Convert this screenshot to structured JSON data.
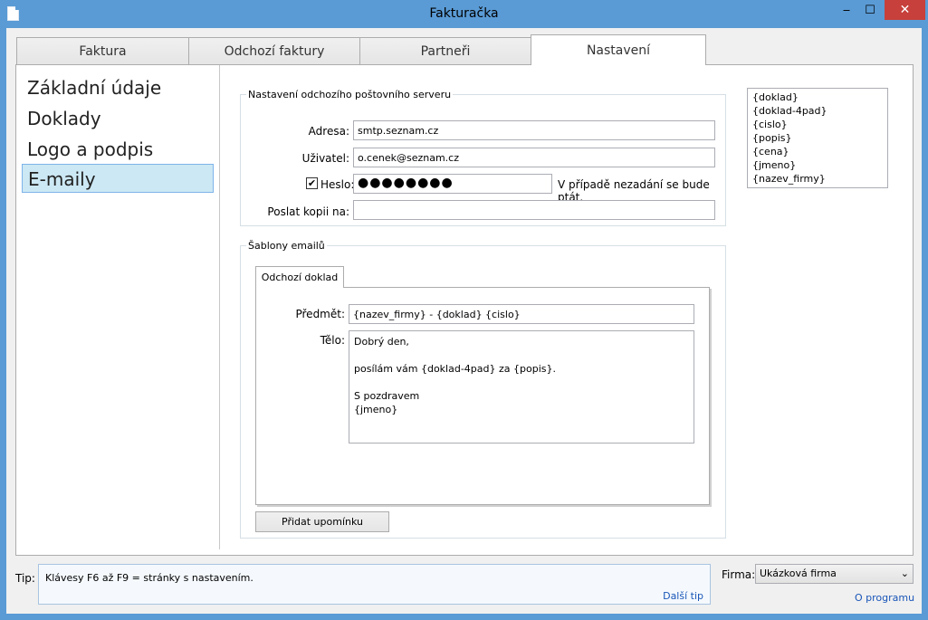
{
  "window": {
    "title": "Fakturačka",
    "minimize": "‒",
    "maximize": "☐",
    "close": "✕"
  },
  "tabs": [
    {
      "label": "Faktura"
    },
    {
      "label": "Odchozí faktury"
    },
    {
      "label": "Partneři"
    },
    {
      "label": "Nastavení",
      "active": true
    }
  ],
  "nav": [
    {
      "label": "Základní údaje"
    },
    {
      "label": "Doklady"
    },
    {
      "label": "Logo a podpis"
    },
    {
      "label": "E-maily",
      "selected": true
    }
  ],
  "smtp": {
    "legend": "Nastavení odchozího poštovního serveru",
    "address_label": "Adresa:",
    "address_value": "smtp.seznam.cz",
    "user_label": "Uživatel:",
    "user_value": "o.cenek@seznam.cz",
    "password_label": "Heslo:",
    "password_checked": true,
    "password_mask": "●●●●●●●●",
    "password_hint": "V případě nezadání se bude ptát.",
    "copy_label": "Poslat kopii na:",
    "copy_value": ""
  },
  "variables": [
    "{doklad}",
    "{doklad-4pad}",
    "{cislo}",
    "{popis}",
    "{cena}",
    "{jmeno}",
    "{nazev_firmy}"
  ],
  "templates": {
    "legend": "Šablony emailů",
    "tab_label": "Odchozí doklad",
    "subject_label": "Předmět:",
    "subject_value": "{nazev_firmy} - {doklad} {cislo}",
    "body_label": "Tělo:",
    "body_value": "Dobrý den,\n\nposílám vám {doklad-4pad} za {popis}.\n\nS pozdravem\n{jmeno}",
    "add_button": "Přidat upomínku"
  },
  "footer": {
    "tip_label": "Tip:",
    "tip_text": "Klávesy F6 až F9 = stránky s nastavením.",
    "next_tip": "Další tip",
    "firma_label": "Firma:",
    "firma_value": "Ukázková firma",
    "about": "O programu"
  }
}
